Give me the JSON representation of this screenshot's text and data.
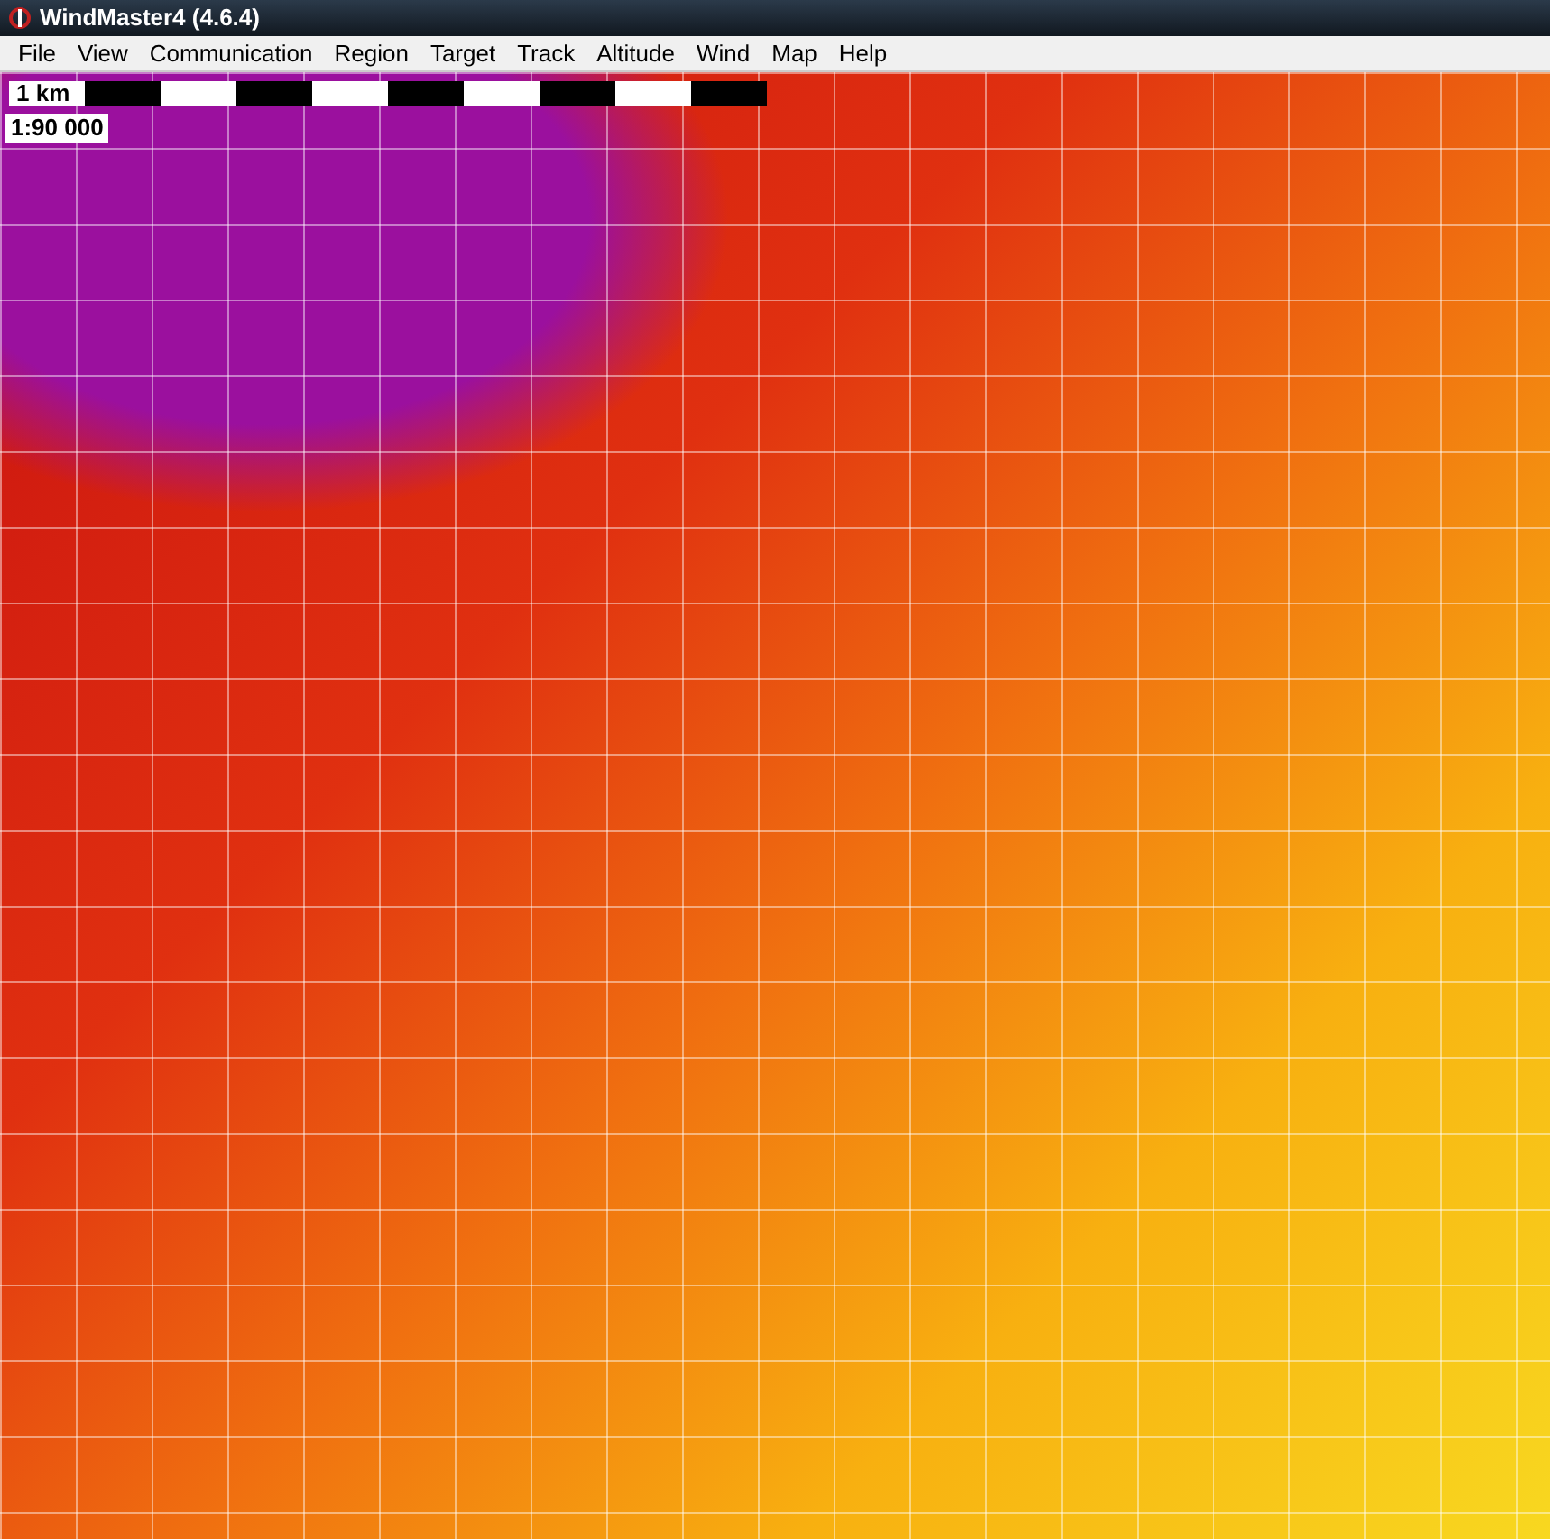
{
  "window": {
    "title": "WindMaster4 (4.6.4)"
  },
  "menu": [
    "File",
    "View",
    "Communication",
    "Region",
    "Target",
    "Track",
    "Altitude",
    "Wind",
    "Map",
    "Help"
  ],
  "map": {
    "scale_bar": {
      "label": "1 km"
    },
    "scale": "1:90 000"
  }
}
